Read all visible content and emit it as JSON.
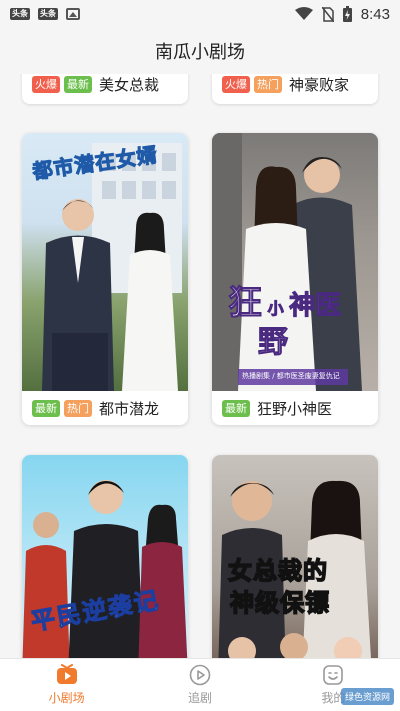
{
  "status_bar": {
    "app_chip_1": "头条",
    "app_chip_2": "头条",
    "time": "8:43"
  },
  "header": {
    "title": "南瓜小剧场"
  },
  "prev_row": [
    {
      "tags": [
        "火爆",
        "最新"
      ],
      "title": "美女总裁"
    },
    {
      "tags": [
        "火爆",
        "热门"
      ],
      "title": "神豪败家"
    }
  ],
  "cards": [
    {
      "poster_text": "都市潜在女婿",
      "tags": [
        "最新",
        "热门"
      ],
      "title": "都市潜龙"
    },
    {
      "poster_text_1": "狂",
      "poster_text_2": "小",
      "poster_text_3": "神医",
      "poster_text_4": "野",
      "poster_sub": "热播剧集 / 都市医圣废妻复仇记",
      "tags": [
        "最新"
      ],
      "title": "狂野小神医"
    },
    {
      "poster_text": "平民逆袭记"
    },
    {
      "poster_text_1": "女总裁的",
      "poster_text_2": "神级保镖"
    }
  ],
  "tab_bar": {
    "tabs": [
      {
        "label": "小剧场",
        "icon": "theater-icon",
        "active": true
      },
      {
        "label": "追剧",
        "icon": "play-circle-icon",
        "active": false
      },
      {
        "label": "我的",
        "icon": "face-icon",
        "active": false
      }
    ],
    "watermark": "绿色资源网"
  },
  "colors": {
    "accent": "#f07b2c",
    "tag_hot": "#f0604c",
    "tag_new": "#6cbf4c",
    "tag_trend": "#f5a05c"
  }
}
